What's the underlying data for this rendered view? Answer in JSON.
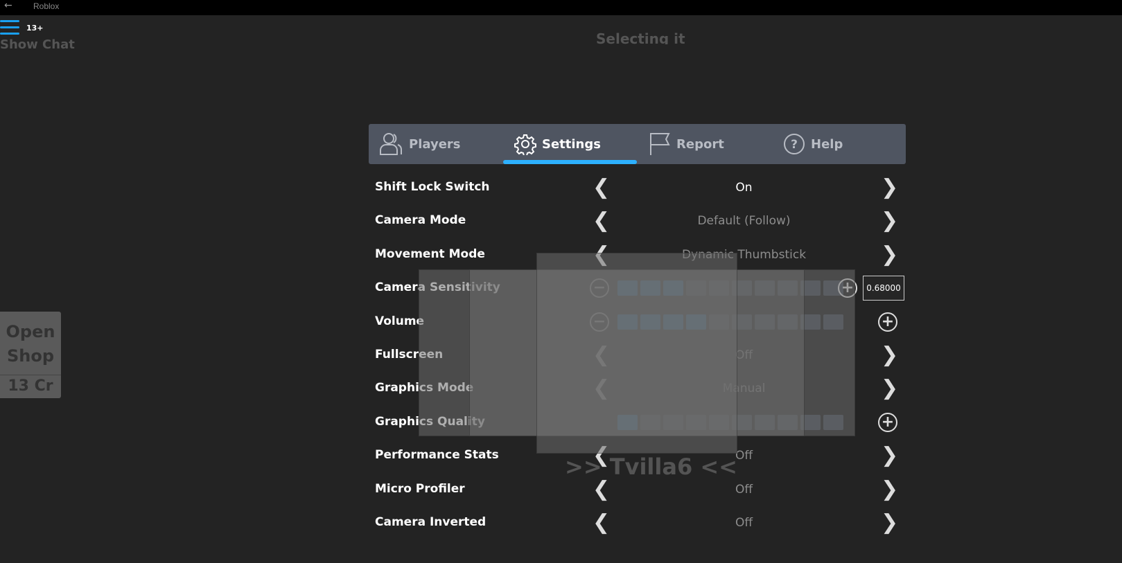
{
  "window": {
    "title": "Roblox",
    "back_icon": "arrow-left-icon"
  },
  "hud": {
    "age_badge": "13+",
    "show_chat": "Show Chat",
    "background_text": "Selecting  it",
    "shop_label": "Open Shop",
    "credits": "13 Cr",
    "player_tag": ">> Tvilla6 <<"
  },
  "tabs": [
    {
      "label": "Players",
      "icon": "players-icon"
    },
    {
      "label": "Settings",
      "icon": "gear-icon",
      "active": true
    },
    {
      "label": "Report",
      "icon": "flag-icon"
    },
    {
      "label": "Help",
      "icon": "help-icon"
    }
  ],
  "settings": [
    {
      "label": "Shift Lock Switch",
      "value": "On"
    },
    {
      "label": "Camera Mode",
      "value": "Default (Follow)"
    },
    {
      "label": "Movement Mode",
      "value": "Dynamic Thumbstick"
    },
    {
      "label": "Camera Sensitivity",
      "level": 3,
      "max": 10,
      "value": "0.68000"
    },
    {
      "label": "Volume",
      "level": 4,
      "max": 10
    },
    {
      "label": "Fullscreen",
      "value": "Off"
    },
    {
      "label": "Graphics Mode",
      "value": "Manual"
    },
    {
      "label": "Graphics Quality",
      "level": 1,
      "max": 10
    },
    {
      "label": "Performance Stats",
      "value": "Off"
    },
    {
      "label": "Micro Profiler",
      "value": "Off"
    },
    {
      "label": "Camera Inverted",
      "value": "Off"
    }
  ],
  "colors": {
    "accent": "#2db1ff",
    "slider_fill": "#1f87c6",
    "tab_bg": "#4f5561"
  }
}
